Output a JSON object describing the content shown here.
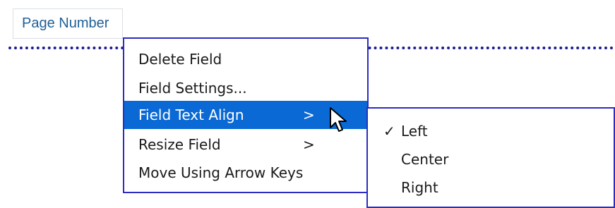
{
  "field": {
    "label": "Page Number"
  },
  "context_menu": {
    "items": [
      {
        "label": "Delete Field",
        "arrow": ""
      },
      {
        "label": "Field Settings...",
        "arrow": ""
      },
      {
        "label": "Field Text Align",
        "arrow": ">"
      },
      {
        "label": "Resize Field",
        "arrow": ">"
      },
      {
        "label": "Move Using Arrow Keys",
        "arrow": ""
      }
    ],
    "highlighted_item": "Field Text Align"
  },
  "submenu": {
    "items": [
      {
        "label": "Left",
        "check": "✓",
        "checked": true
      },
      {
        "label": "Center",
        "check": "",
        "checked": false
      },
      {
        "label": "Right",
        "check": "",
        "checked": false
      }
    ]
  },
  "colors": {
    "highlight": "#0a69d4",
    "menu_border": "#2c2cc5",
    "dotted_line": "#1b1d92",
    "field_text": "#1f5f97"
  },
  "icons": {
    "cursor": "mouse-pointer-icon",
    "check": "checkmark-icon"
  }
}
